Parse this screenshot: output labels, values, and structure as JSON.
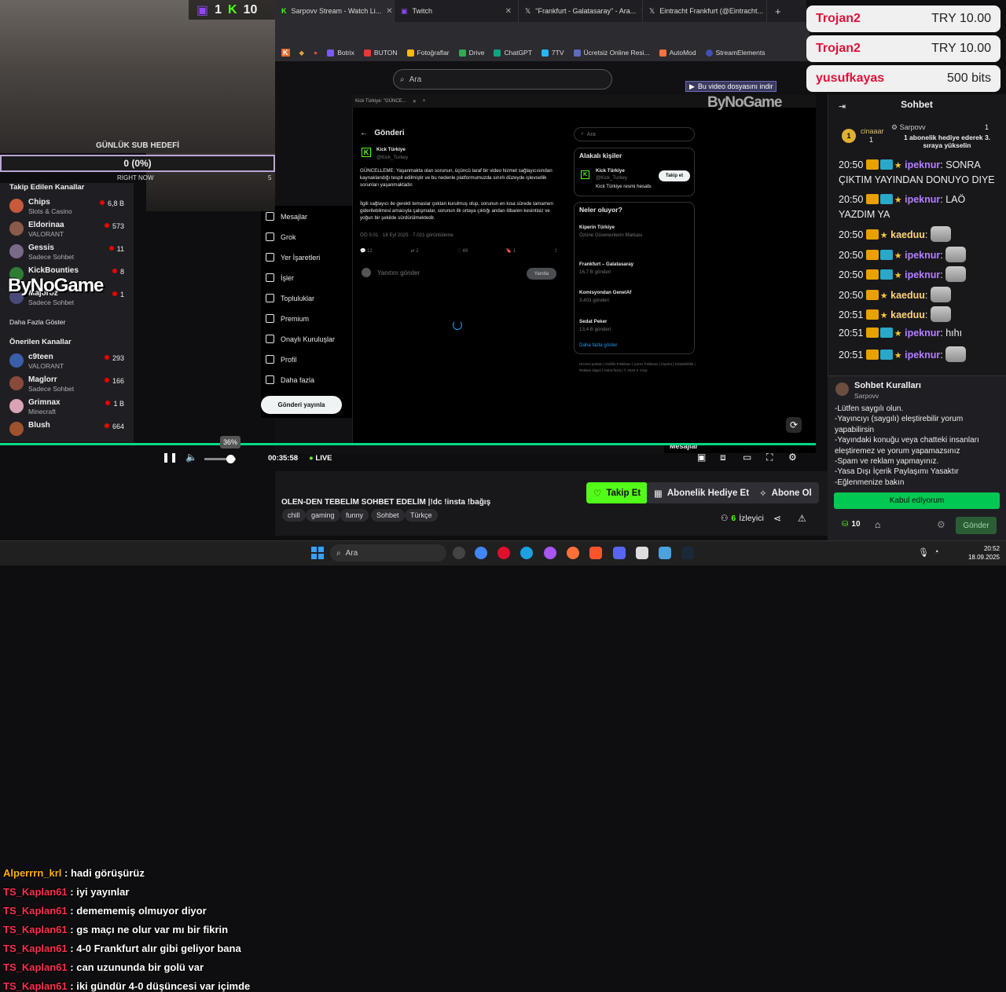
{
  "counters": {
    "twitch_count": "1",
    "kick_count": "10"
  },
  "goal": {
    "title": "GÜNLÜK SUB HEDEFİ",
    "value": "0 (0%)",
    "left_label": "RIGHT NOW",
    "right_label": "5"
  },
  "browser": {
    "tabs": [
      {
        "label": "Sarpovv Stream - Watch Li..."
      },
      {
        "label": "Twitch"
      },
      {
        "label": "\"Frankfurt - Galatasaray\" - Ara..."
      },
      {
        "label": "Eintracht Frankfurt (@Eintracht..."
      }
    ],
    "new_tab": "+",
    "bookmarks": [
      "Botrix",
      "BUTON",
      "Fotoğraflar",
      "Drive",
      "ChatGPT",
      "7TV",
      "Ücretsiz Online Resi...",
      "AutoMod",
      "StreamElements"
    ],
    "search_placeholder": "Ara",
    "download_notice": "Bu video dosyasını indir"
  },
  "sidebar": {
    "followed_title": "Takip Edilen Kanallar",
    "followed": [
      {
        "name": "Chips",
        "game": "Slots & Casino",
        "viewers": "6,8 B",
        "color": "#c75a3a"
      },
      {
        "name": "Eldorinaa",
        "game": "VALORANT",
        "viewers": "573",
        "color": "#8a5a4a"
      },
      {
        "name": "Gessis",
        "game": "Sadece Sohbet",
        "viewers": "11",
        "color": "#7a6a8a"
      },
      {
        "name": "KickBounties",
        "game": "",
        "viewers": "8",
        "color": "#2e7d32"
      },
      {
        "name": "Majoroz",
        "game": "Sadece Sohbet",
        "viewers": "1",
        "color": "#4a4a7a"
      }
    ],
    "show_more": "Daha Fazla Göster",
    "recommended_title": "Önerilen Kanallar",
    "recommended": [
      {
        "name": "c9teen",
        "game": "VALORANT",
        "viewers": "293",
        "color": "#3b5ea8"
      },
      {
        "name": "Maglorr",
        "game": "Sadece Sohbet",
        "viewers": "166",
        "color": "#8a4a3a"
      },
      {
        "name": "Grimnax",
        "game": "Minecraft",
        "viewers": "1 B",
        "color": "#d9a3b5"
      },
      {
        "name": "Blush",
        "game": "",
        "viewers": "664",
        "color": "#a0522d"
      }
    ],
    "overlay_logo": "ByNoGame"
  },
  "twitter": {
    "inner_tab": "Kick Türkiye: \"GÜNCE...",
    "header": "Gönderi",
    "author": "Kick Türkiye",
    "handle": "@Kick_Turkey",
    "post_p1": "GÜNCELLEME: Yaşanmakta olan sorunun, üçüncü taraf bir video hizmet sağlayıcısından kaynaklandığı tespit edilmiştir ve bu nedenle platformumuzda sınırlı düzeyde işlevsellik sorunları yaşanmaktadır.",
    "post_p2": "İlgili sağlayıcı ile gerekli temaslar çoktan kurulmuş olup, sorunun en kısa sürede tamamen giderilebilmesi amacıyla çalışmalar, sorunun ilk ortaya çıktığı andan itibaren kesintisiz ve yoğun bir şekilde sürdürülmektedir.",
    "meta": "ÖÖ 5:01 · 18 Eyl 2025 · 7.021 görüntüleme",
    "stats": [
      "12",
      "2",
      "49",
      "1"
    ],
    "reply_placeholder": "Yanıtını gönder",
    "reply_button": "Yanıtla",
    "nav": [
      "Mesajlar",
      "Grok",
      "Yer İşaretleri",
      "İşler",
      "Topluluklar",
      "Premium",
      "Onaylı Kuruluşlar",
      "Profil",
      "Daha fazla"
    ],
    "post_button": "Gönderi yayınla",
    "search_placeholder": "Ara",
    "related_title": "Alakalı kişiler",
    "related_name": "Kick Türkiye",
    "related_handle": "@Kick_Turkey",
    "related_bio": "Kick Türkiye resmi hesabı",
    "follow": "Takip et",
    "trends_title": "Neler oluyor?",
    "trends": [
      {
        "title": "Kiperin Türkiye",
        "sub": "Özüne Güvenenlerin Markası"
      },
      {
        "title": "Frankfurt – Galatasaray",
        "sub": "16,7 B gönderi"
      },
      {
        "title": "Komisyondan GenelAf",
        "sub": "3.403 gönderi"
      },
      {
        "title": "Sedat Peker",
        "sub": "13,4 B gönderi"
      }
    ],
    "show_more": "Daha fazla göster",
    "footer": "Hizmet Şartları | Gizlilik Politikası | Çerez Politikası | İmprint | Erişilebilirlik | Reklam bilgisi | Daha fazla | © 2025 X Corp.",
    "dm_label": "Mesajlar",
    "overlay_logo": "ByNoGame"
  },
  "player": {
    "volume": "36%",
    "time": "00:35:58",
    "live": "LIVE"
  },
  "stream": {
    "title": "OLEN-DEN TEBELİM SOHBET EDELİM |!dc !insta !bağış",
    "tags": [
      "chill",
      "gaming",
      "funny",
      "Sohbet",
      "Türkçe"
    ],
    "follow": "Takip Et",
    "gift": "Abonelik Hediye Et",
    "subscribe": "Abone Ol",
    "viewers": "6",
    "viewers_label": "İzleyici"
  },
  "alert_chat": [
    {
      "user": "Alperrrn_krl",
      "msg": "hadi görüşürüz",
      "color": "#ffb300"
    },
    {
      "user": "TS_Kaplan61",
      "msg": "iyi yayınlar"
    },
    {
      "user": "TS_Kaplan61",
      "msg": "demememiş olmuyor diyor"
    },
    {
      "user": "TS_Kaplan61",
      "msg": "gs maçı ne olur var mı bir fikrin"
    },
    {
      "user": "TS_Kaplan61",
      "msg": "4-0 Frankfurt alır gibi geliyor bana"
    },
    {
      "user": "TS_Kaplan61",
      "msg": "can uzununda bir golü var"
    },
    {
      "user": "TS_Kaplan61",
      "msg": "iki gündür 4-0 düşüncesi var içimde"
    }
  ],
  "donations": [
    {
      "user": "Trojan2",
      "amount": "TRY 10.00"
    },
    {
      "user": "Trojan2",
      "amount": "TRY 10.00"
    },
    {
      "user": "yusufkayas",
      "amount": "500 bits"
    }
  ],
  "chat": {
    "title": "Sohbet",
    "pinned_user": "cinaaar",
    "pinned_count": "1",
    "pinned_streamer": "Sarpovv",
    "pinned_streamer_count": "1",
    "pinned_text": "1 abonelik hediye ederek 3. sıraya yükselin",
    "messages": [
      {
        "time": "20:50",
        "user": "ipeknur",
        "text": "SONRA ÇIKTIM YAYINDAN DONUYO DIYE",
        "cls": "n"
      },
      {
        "time": "20:50",
        "user": "ipeknur",
        "text": "LAÖ YAZDIM YA",
        "cls": "n"
      },
      {
        "time": "20:50",
        "user": "kaeduu",
        "text": "",
        "cls": "n2"
      },
      {
        "time": "20:50",
        "user": "ipeknur",
        "text": "",
        "cls": "n"
      },
      {
        "time": "20:50",
        "user": "ipeknur",
        "text": "",
        "cls": "n"
      },
      {
        "time": "20:50",
        "user": "kaeduu",
        "text": "",
        "cls": "n2"
      },
      {
        "time": "20:51",
        "user": "kaeduu",
        "text": "",
        "cls": "n2"
      },
      {
        "time": "20:51",
        "user": "ipeknur",
        "text": "hıhı",
        "cls": "n"
      },
      {
        "time": "20:51",
        "user": "ipeknur",
        "text": "",
        "cls": "n"
      }
    ],
    "rules_title": "Sohbet Kuralları",
    "rules_author": "Sarpovv",
    "rules": "-Lütfen saygılı olun.\n-Yayıncıyı (saygılı) eleştirebilir yorum yapabilirsin\n-Yayındaki konuğu veya chatteki insanları eleştiremez ve yorum yapamazsınız\n-Spam ve reklam yapmayınız.\n-Yasa Dışı İçerik Paylaşımı Yasaktır\n-Eğlenmenize bakın",
    "accept": "Kabul ediyorum",
    "points": "10",
    "send": "Gönder"
  },
  "taskbar": {
    "search": "Ara",
    "time": "20:52",
    "date": "18.09.2025"
  }
}
